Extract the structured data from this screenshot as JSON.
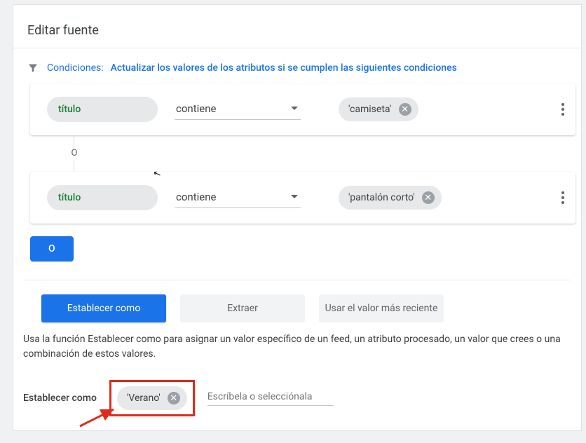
{
  "page": {
    "title": "Editar fuente"
  },
  "conditions": {
    "label": "Condiciones:",
    "link_text": "Actualizar los valores de los atributos si se cumplen las siguientes condiciones",
    "or_label": "O",
    "add_or_label": "O"
  },
  "rules": [
    {
      "attribute": "título",
      "operator": "contiene",
      "value": "'camiseta'"
    },
    {
      "attribute": "título",
      "operator": "contiene",
      "value": "'pantalón corto'"
    }
  ],
  "action_tabs": {
    "set_as": "Establecer como",
    "extract": "Extraer",
    "use_latest": "Usar el valor más reciente"
  },
  "action_desc": "Usa la función Establecer como para asignar un valor específico de un feed, un atributo procesado, un valor que crees o una combinación de estos valores.",
  "set_as": {
    "label": "Establecer como",
    "chip": "'Verano'",
    "placeholder": "Escríbela o selecciónala"
  }
}
